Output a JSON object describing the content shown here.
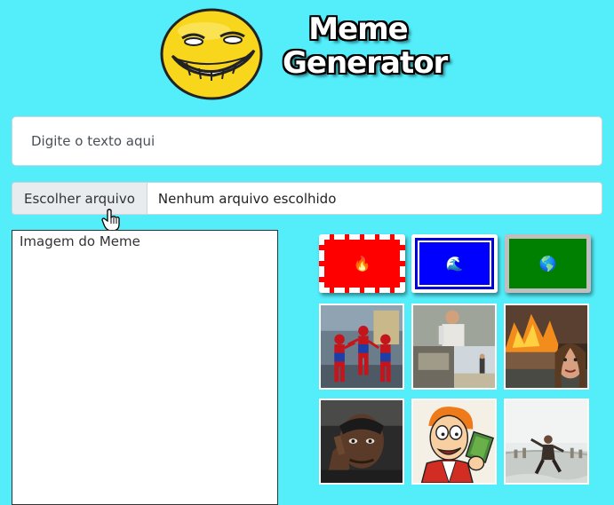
{
  "header": {
    "title_line1": "Meme",
    "title_line2": "Generator",
    "logo_icon": "troll-face-icon"
  },
  "text_input": {
    "placeholder": "Digite o texto aqui",
    "value": ""
  },
  "file_input": {
    "button_label": "Escolher arquivo",
    "status": "Nenhum arquivo escolhido"
  },
  "preview": {
    "alt_text": "Imagem do Meme"
  },
  "themes": [
    {
      "name": "fire",
      "icon": "fire-icon",
      "glyph": "🔥",
      "color": "#ff0000"
    },
    {
      "name": "water",
      "icon": "wave-icon",
      "glyph": "🌊",
      "color": "#0000ff"
    },
    {
      "name": "earth",
      "icon": "globe-icon",
      "glyph": "🌎",
      "color": "#008000"
    }
  ],
  "thumbnails": [
    {
      "name": "spiderman-pointing-meme"
    },
    {
      "name": "sad-man-waiting-meme"
    },
    {
      "name": "disaster-girl-meme"
    },
    {
      "name": "thinking-man-meme"
    },
    {
      "name": "fry-money-meme"
    },
    {
      "name": "jack-sparrow-running-meme"
    }
  ]
}
